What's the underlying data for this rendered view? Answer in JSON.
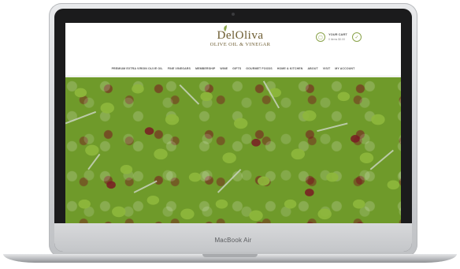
{
  "device": {
    "brand_label": "MacBook Air"
  },
  "site": {
    "logo": {
      "main": "DelOliva",
      "sub": "OLIVE OIL & VINEGAR"
    },
    "cart": {
      "title": "YOUR CART",
      "count": "0 items $0.00"
    },
    "nav": [
      "Premium Extra Virgin Olive Oil",
      "Fine Vinegars",
      "Membership",
      "Wine",
      "Gifts",
      "Gourmet Foods",
      "Home & Kitchen",
      "About",
      "Visit",
      "My Account"
    ]
  },
  "colors": {
    "logo": "#6b5a2e",
    "accent_green": "#8aa34a",
    "olive_green": "#6f9a2a",
    "olive_dark": "#78141e"
  },
  "icons": [
    "leaf-icon",
    "cart-icon",
    "checkout-icon"
  ]
}
